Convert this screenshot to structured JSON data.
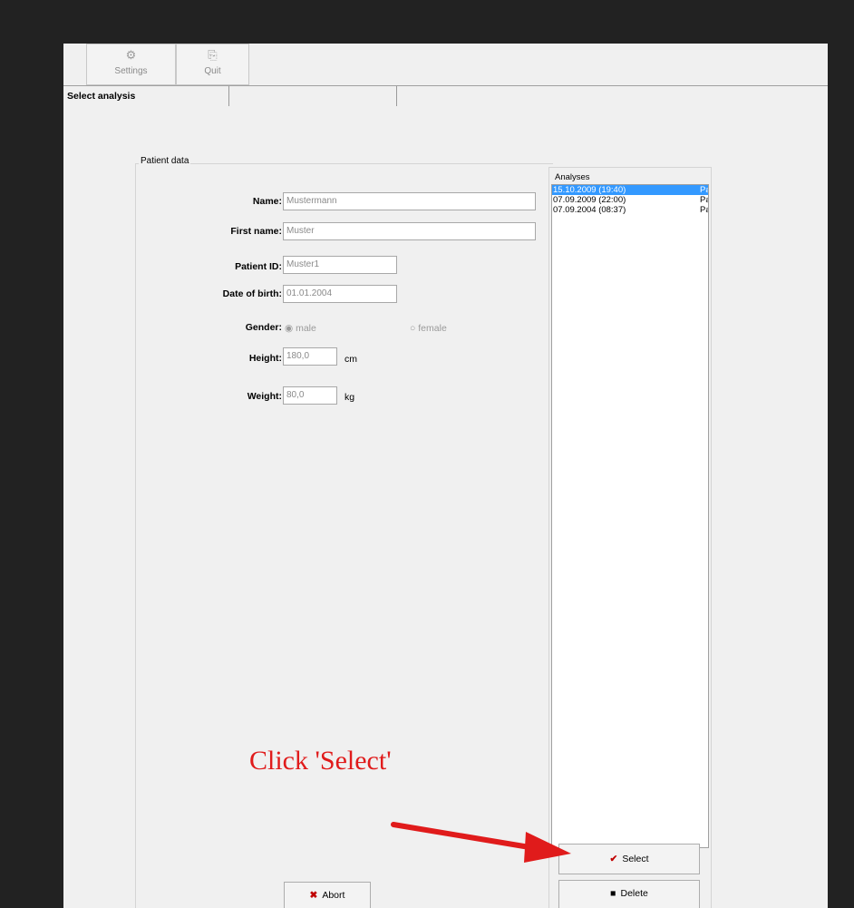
{
  "toolbar": {
    "settings": {
      "label": "Settings",
      "icon": "settings-icon"
    },
    "quit": {
      "label": "Quit",
      "icon": "quit-icon"
    }
  },
  "tabs": [
    {
      "label": "Select analysis",
      "active": true
    },
    {
      "label": ""
    }
  ],
  "patient": {
    "group_title": "Patient data",
    "name_label": "Name:",
    "name_value": "Mustermann",
    "first_name_label": "First name:",
    "first_name_value": "Muster",
    "patient_id_label": "Patient ID:",
    "patient_id_value": "Muster1",
    "dob_label": "Date of birth:",
    "dob_value": "01.01.2004",
    "gender_label": "Gender:",
    "gender_male": "male",
    "gender_female": "female",
    "gender_selected": "male",
    "height_label": "Height:",
    "height_value": "180,0",
    "height_unit": "cm",
    "weight_label": "Weight:",
    "weight_value": "80,0",
    "weight_unit": "kg"
  },
  "analyses": {
    "group_title": "Analyses",
    "items": [
      {
        "date": "15.10.2009",
        "time": "(19:40)",
        "kind": "Pa",
        "selected": true
      },
      {
        "date": "07.09.2009",
        "time": "(22:00)",
        "kind": "Pa",
        "selected": false
      },
      {
        "date": "07.09.2004",
        "time": "(08:37)",
        "kind": "Pa",
        "selected": false
      }
    ]
  },
  "buttons": {
    "select": "Select",
    "delete": "Delete",
    "abort": "Abort"
  },
  "annotation": {
    "text": "Click 'Select'",
    "color": "#e01b1b"
  },
  "colors": {
    "selection": "#3399ff",
    "background": "#222222",
    "window": "#f0f0f0"
  }
}
